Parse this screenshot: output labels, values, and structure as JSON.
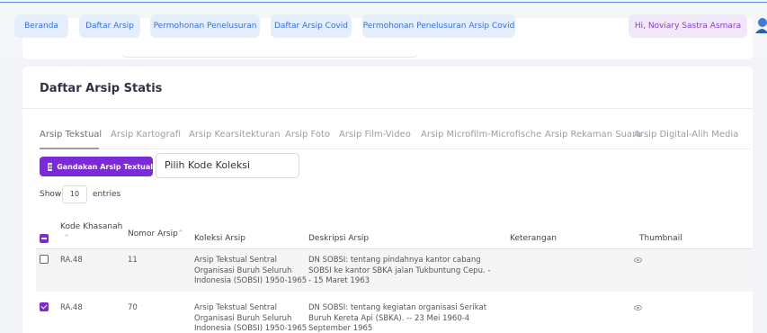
{
  "nav": {
    "tabs": [
      {
        "label": "Beranda"
      },
      {
        "label": "Daftar Arsip"
      },
      {
        "label": "Permohonan Penelusuran"
      },
      {
        "label": "Daftar Arsip Covid"
      },
      {
        "label": "Permohonan Penelusuran Arsip Covid"
      }
    ],
    "greeting": "Hi, Noviary Sastra Asmara"
  },
  "card": {
    "title": "Daftar Arsip Statis"
  },
  "subtabs": [
    {
      "label": "Arsip Tekstual",
      "active": true
    },
    {
      "label": "Arsip Kartografi"
    },
    {
      "label": "Arsip Kearsitekturan"
    },
    {
      "label": "Arsip Foto"
    },
    {
      "label": "Arsip Film-Video"
    },
    {
      "label": "Arsip Microfilm-Microfische"
    },
    {
      "label": "Arsip Rekaman Suara"
    },
    {
      "label": "Arsip Digital-Alih Media"
    }
  ],
  "toolbar": {
    "download_label": "Gandakan Arsip Textual",
    "select_value": "Pilih Kode Koleksi"
  },
  "length": {
    "show_label": "Show",
    "value": "10",
    "entries_label": "entries"
  },
  "table": {
    "headers": {
      "kode_line1": "Kode Khasanah",
      "kode_sort": "^",
      "nomor": "Nomor Arsip",
      "nomor_sort": "^",
      "koleksi": "Koleksi Arsip",
      "deskripsi": "Deskripsi Arsip",
      "keterangan": "Keterangan",
      "thumbnail": "Thumbnail"
    },
    "rows": [
      {
        "checked": false,
        "kode": "RA.48",
        "nomor": "11",
        "koleksi": [
          "Arsip Tekstual Sentral",
          "Organisasi Buruh Seluruh",
          "Indonesia (SOBSI) 1950-1965"
        ],
        "deskripsi": [
          "DN SOBSI: tentang pindahnya kantor cabang",
          "SOBSI ke kantor SBKA jalan Tukbuntung Cepu. -",
          "- 15 Maret 1963"
        ],
        "keterangan": ""
      },
      {
        "checked": true,
        "kode": "RA.48",
        "nomor": "70",
        "koleksi": [
          "Arsip Tekstual Sentral",
          "Organisasi Buruh Seluruh",
          "Indonesia (SOBSI) 1950-1965"
        ],
        "deskripsi": [
          "DN SOBSI: tentang kegiatan organisasi Serikat",
          "Buruh Kereta Api (SBKA). -- 23 Mei 1960-4",
          "September 1965"
        ],
        "keterangan": ""
      }
    ]
  },
  "colors": {
    "accent": "#7a2bd6",
    "nav_tab_bg": "#e4effb",
    "nav_tab_text": "#3a6fd8"
  }
}
